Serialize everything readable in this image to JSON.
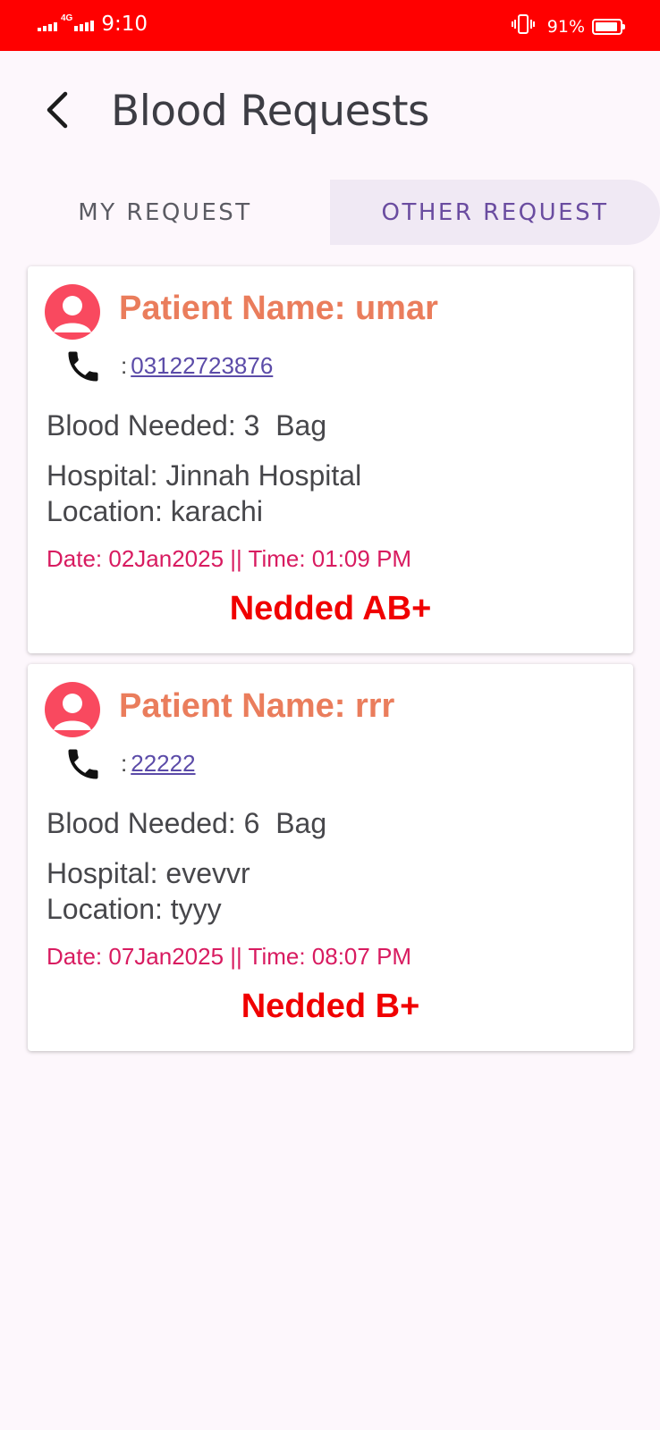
{
  "status_bar": {
    "time": "9:10",
    "network": "4G",
    "battery_pct": "91%",
    "battery_level": 0.91
  },
  "header": {
    "title": "Blood Requests"
  },
  "tabs": [
    {
      "label": "MY REQUEST",
      "selected": false
    },
    {
      "label": "OTHER REQUEST",
      "selected": true
    }
  ],
  "requests": [
    {
      "patient": "Patient Name: umar",
      "phone_prefix": ":",
      "phone": "03122723876",
      "blood_needed": "Blood Needed: 3  Bag",
      "hospital": "Hospital: Jinnah Hospital",
      "location": "Location: karachi",
      "datetime": "Date: 02Jan2025 || Time: 01:09 PM",
      "needed": "Nedded AB+"
    },
    {
      "patient": "Patient Name: rrr",
      "phone_prefix": ":",
      "phone": "22222",
      "blood_needed": "Blood Needed: 6  Bag",
      "hospital": "Hospital: evevvr",
      "location": "Location: tyyy",
      "datetime": "Date: 07Jan2025 || Time: 08:07 PM",
      "needed": "Nedded B+"
    }
  ],
  "colors": {
    "status_bar": "#ff0000",
    "accent_tab": "#6a4ca0",
    "patient_name": "#ea7d5c",
    "avatar": "#f9495f",
    "date": "#d81b60",
    "needed": "#f00000"
  }
}
